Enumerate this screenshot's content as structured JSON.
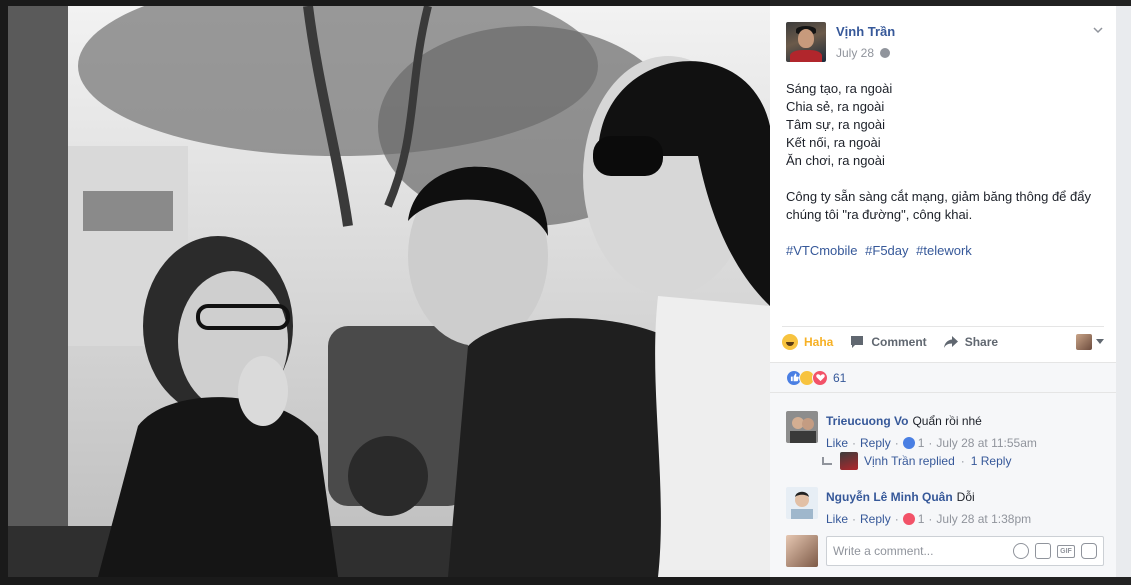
{
  "post": {
    "author": "Vịnh Trần",
    "date": "July 28",
    "lines": [
      "Sáng tạo, ra ngoài",
      "Chia sẻ, ra ngoài",
      "Tâm sự, ra ngoài",
      "Kết nối, ra ngoài",
      "Ăn chơi, ra ngoài"
    ],
    "paragraph": "Công ty sẵn sàng cắt mạng, giảm băng thông để đẩy chúng tôi \"ra đường\", công khai.",
    "hashtags": [
      "#VTCmobile",
      "#F5day",
      "#telework"
    ]
  },
  "actions": {
    "haha": "Haha",
    "comment": "Comment",
    "share": "Share"
  },
  "reactions": {
    "count": "61",
    "types": [
      "like-icon",
      "haha-icon",
      "love-icon"
    ]
  },
  "comments": [
    {
      "name": "Trieucuong Vo",
      "text": "Quẩn rồi nhé",
      "like": "Like",
      "reply": "Reply",
      "reaction_count": "1",
      "time": "July 28 at 11:55am"
    },
    {
      "name": "Nguyễn Lê Minh Quân",
      "text": "Dỗi",
      "like": "Like",
      "reply": "Reply",
      "reaction_count": "1",
      "time": "July 28 at 1:38pm"
    }
  ],
  "reply_summary": {
    "author": "Vịnh Trần",
    "replied": "replied",
    "count": "1 Reply"
  },
  "composer": {
    "placeholder": "Write a comment...",
    "gif": "GIF"
  },
  "colors": {
    "link": "#365899",
    "haha": "#f7b125",
    "like": "#4a7fe3",
    "love": "#f25268"
  }
}
